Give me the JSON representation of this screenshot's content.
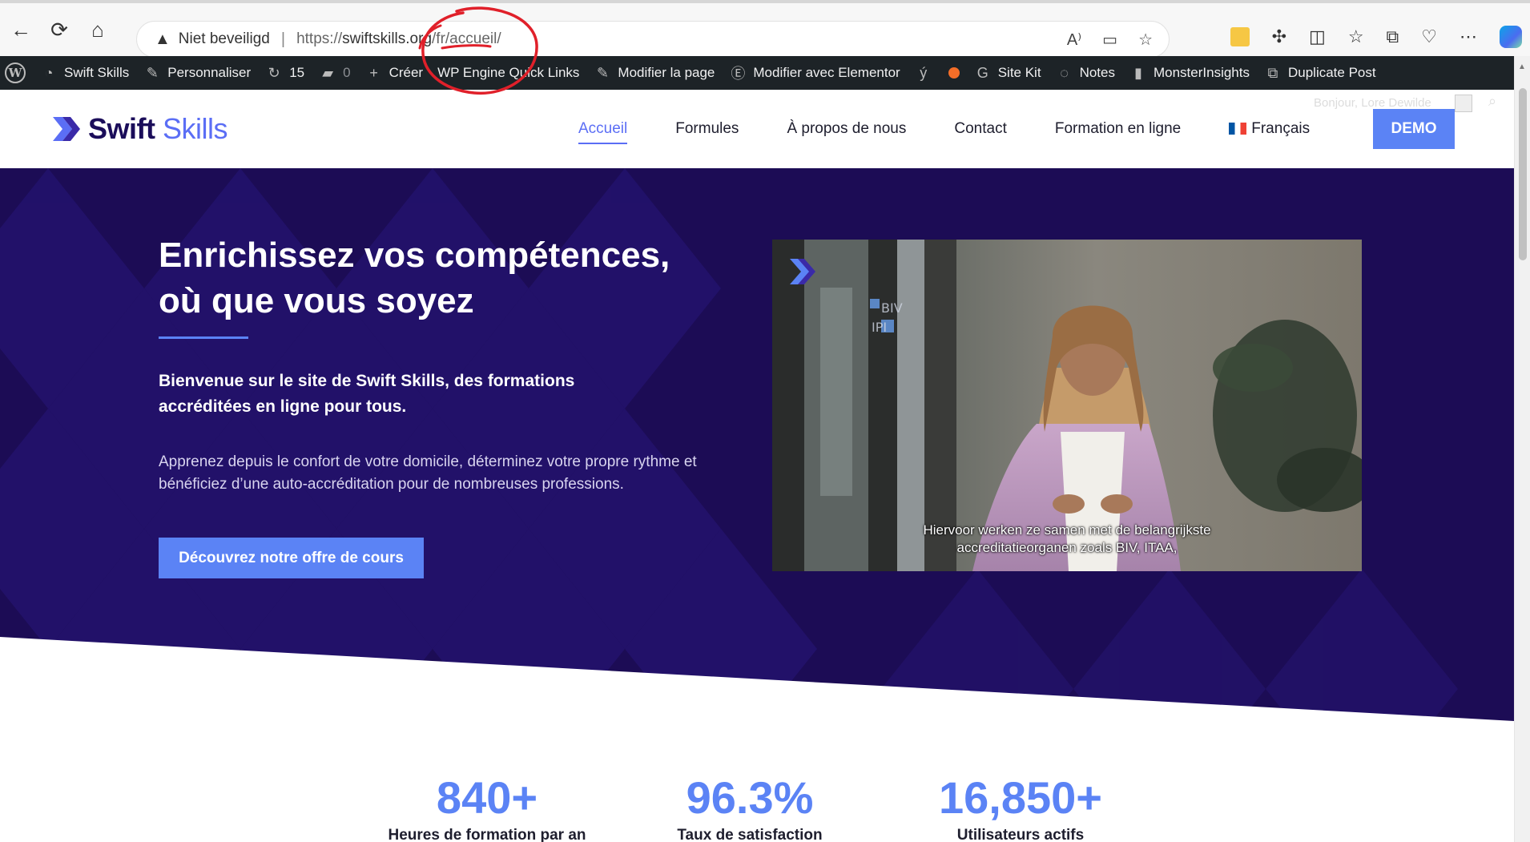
{
  "browser": {
    "security_label": "Niet beveiligd",
    "url_prefix": "https://",
    "url_host": "swiftskills.org",
    "url_path": "/fr/accueil/"
  },
  "wp_admin_bar": {
    "site_name": "Swift Skills",
    "customize": "Personnaliser",
    "updates_count": "15",
    "comments_count": "0",
    "new": "Créer",
    "wp_engine": "WP Engine Quick Links",
    "edit_page": "Modifier la page",
    "edit_elementor": "Modifier avec Elementor",
    "site_kit": "Site Kit",
    "notes": "Notes",
    "monster_insights": "MonsterInsights",
    "duplicate_post": "Duplicate Post"
  },
  "header": {
    "logo_bold": "Swift",
    "logo_light": "Skills",
    "greeting": "Bonjour, Lore Dewilde",
    "nav": [
      {
        "label": "Accueil",
        "active": true
      },
      {
        "label": "Formules"
      },
      {
        "label": "À propos de nous"
      },
      {
        "label": "Contact"
      },
      {
        "label": "Formation en ligne"
      }
    ],
    "language": "Français",
    "demo_label": "DEMO"
  },
  "hero": {
    "title_line1": "Enrichissez vos compétences,",
    "title_line2": "où que vous soyez",
    "subtitle": "Bienvenue sur le site de Swift Skills, des formations accréditées en ligne pour tous.",
    "description": "Apprenez depuis le confort de votre domicile, déterminez votre propre rythme et bénéficiez d’une auto-accréditation pour de nombreuses professions.",
    "cta": "Découvrez notre offre de cours",
    "video_subtitle_line1": "Hiervoor werken ze samen met de belangrijkste",
    "video_subtitle_line2": "accreditatieorganen zoals BIV, ITAA,",
    "video_sign_line1": "BIV",
    "video_sign_line2": "IPI"
  },
  "stats": [
    {
      "value": "840+",
      "label": "Heures de formation par an"
    },
    {
      "value": "96.3%",
      "label": "Taux de satisfaction"
    },
    {
      "value": "16,850+",
      "label": "Utilisateurs actifs"
    }
  ],
  "colors": {
    "accent": "#5b83f5",
    "brand_dark": "#1b0d5a",
    "hero_bg": "#1c0c55",
    "annotation_red": "#e0202a"
  }
}
